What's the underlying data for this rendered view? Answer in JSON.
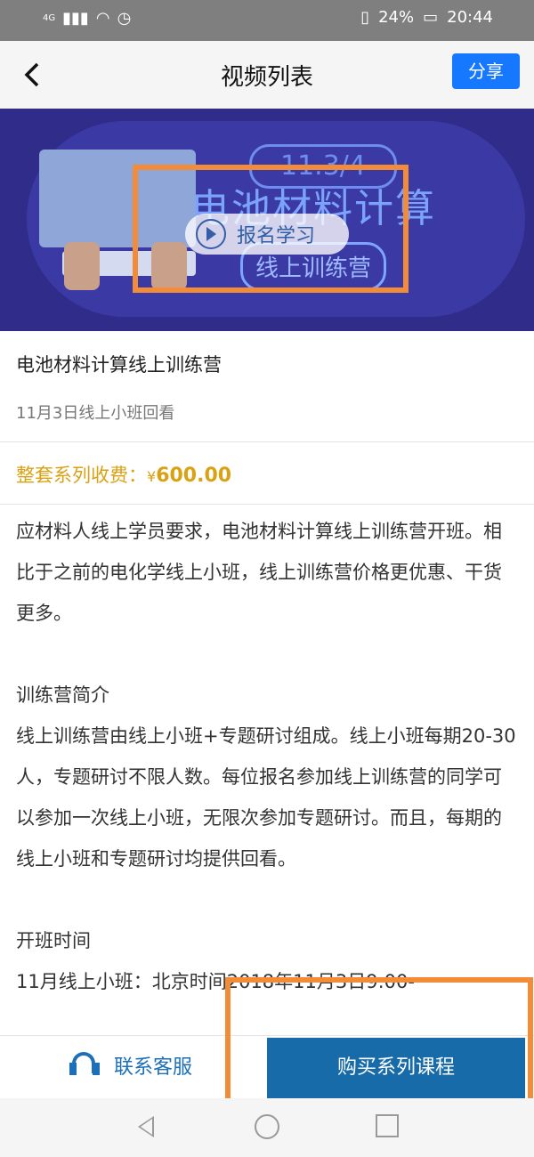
{
  "status_bar": {
    "network": "4G",
    "battery": "24%",
    "time": "20:44"
  },
  "header": {
    "title": "视频列表",
    "share_label": "分享"
  },
  "banner": {
    "badge": "11.3/4",
    "title": "电池材料计算",
    "subtitle": "线上训练营",
    "play_label": "报名学习"
  },
  "course": {
    "title": "电池材料计算线上训练营",
    "subtitle": "11月3日线上小班回看"
  },
  "price": {
    "label": "整套系列收费：",
    "currency": "¥",
    "amount": "600.00"
  },
  "content": {
    "intro": "应材料人线上学员要求，电池材料计算线上训练营开班。相比于之前的电化学线上小班，线上训练营价格更优惠、干货更多。",
    "section1_title": "训练营简介",
    "section1_body": "线上训练营由线上小班+专题研讨组成。线上小班每期20-30人，专题研讨不限人数。每位报名参加线上训练营的同学可以参加一次线上小班，无限次参加专题研讨。而且，每期的线上小班和专题研讨均提供回看。",
    "section2_title": "开班时间",
    "section2_body": "11月线上小班：北京时间2018年11月3日9:00-"
  },
  "bottom_bar": {
    "service_label": "联系客服",
    "buy_label": "购买系列课程"
  },
  "colors": {
    "accent": "#1677ff",
    "price": "#d9a214",
    "buy_button": "#176ba8",
    "highlight": "#f28c39"
  }
}
